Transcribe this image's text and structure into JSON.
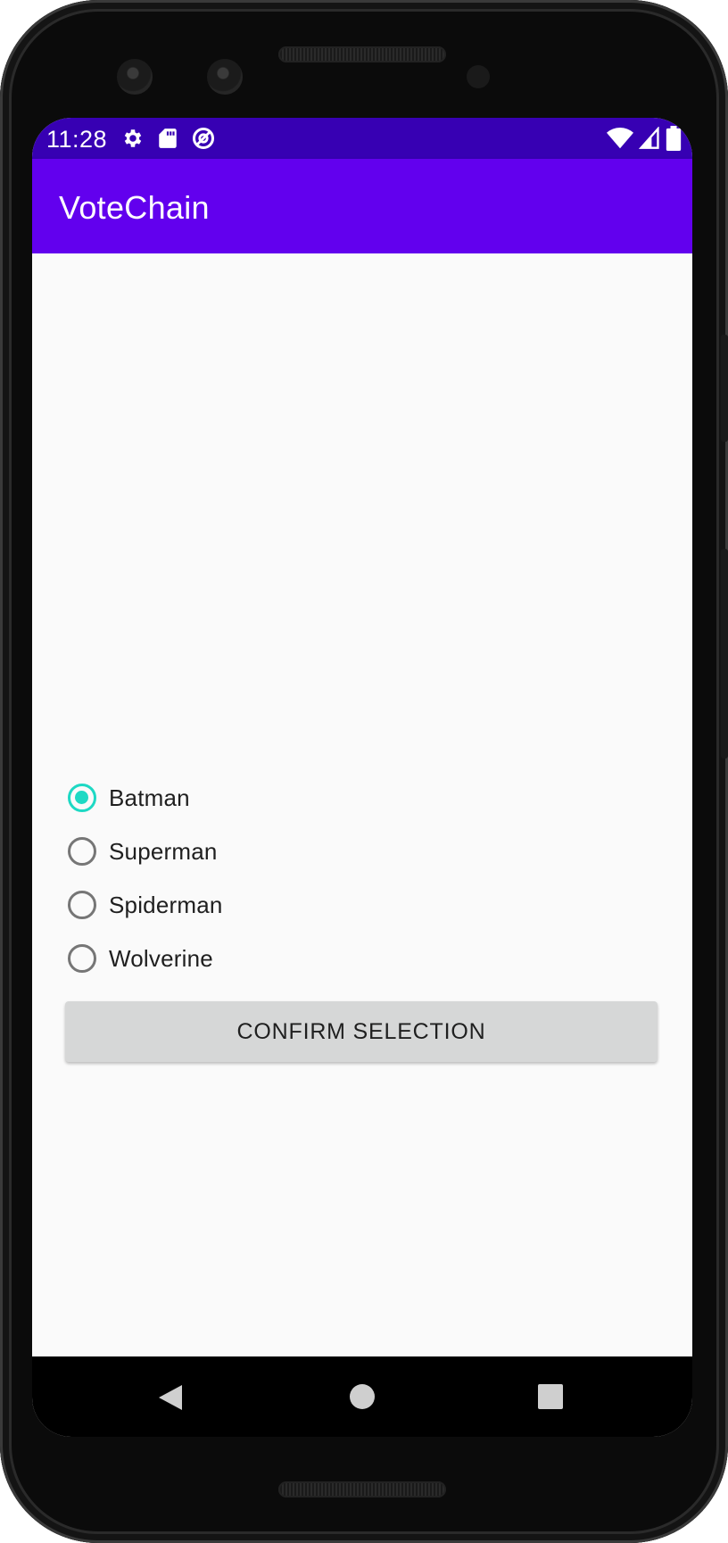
{
  "status_bar": {
    "time": "11:28",
    "left_icons": [
      "gear-icon",
      "sd-card-icon",
      "data-saver-icon"
    ],
    "right_icons": [
      "wifi-icon",
      "cell-signal-icon",
      "battery-icon"
    ],
    "background": "#3700b3"
  },
  "app_bar": {
    "title": "VoteChain",
    "background": "#6200ee"
  },
  "vote": {
    "options": [
      {
        "label": "Batman",
        "checked": true
      },
      {
        "label": "Superman",
        "checked": false
      },
      {
        "label": "Spiderman",
        "checked": false
      },
      {
        "label": "Wolverine",
        "checked": false
      }
    ],
    "accent": "#1ed9c4",
    "confirm_label": "CONFIRM SELECTION"
  },
  "nav_bar": {
    "icons": [
      "back-icon",
      "home-icon",
      "recents-icon"
    ]
  }
}
